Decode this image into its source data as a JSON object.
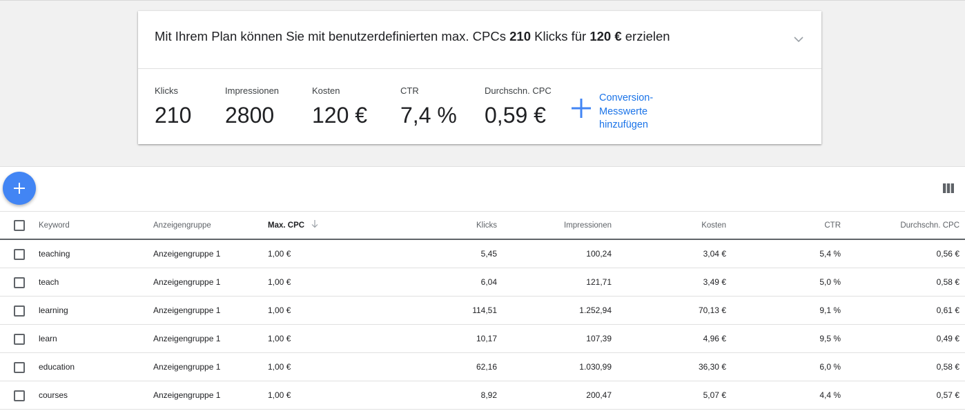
{
  "summary": {
    "plan_prefix": "Mit Ihrem Plan können Sie mit benutzerdefinierten max. CPCs ",
    "plan_clicks": "210",
    "plan_mid": " Klicks für ",
    "plan_cost": "120 €",
    "plan_suffix": " erzielen",
    "metrics": [
      {
        "label": "Klicks",
        "value": "210"
      },
      {
        "label": "Impressionen",
        "value": "2800"
      },
      {
        "label": "Kosten",
        "value": "120 €"
      },
      {
        "label": "CTR",
        "value": "7,4 %"
      },
      {
        "label": "Durchschn. CPC",
        "value": "0,59 €"
      }
    ],
    "conversion_line1": "Conversion-",
    "conversion_line2": "Messwerte",
    "conversion_line3": "hinzufügen"
  },
  "table": {
    "headers": {
      "keyword": "Keyword",
      "adgroup": "Anzeigengruppe",
      "maxcpc": "Max. CPC",
      "clicks": "Klicks",
      "impressions": "Impressionen",
      "cost": "Kosten",
      "ctr": "CTR",
      "avgcpc": "Durchschn. CPC"
    },
    "rows": [
      {
        "keyword": "teaching",
        "adgroup": "Anzeigengruppe 1",
        "maxcpc": "1,00 €",
        "clicks": "5,45",
        "impressions": "100,24",
        "cost": "3,04 €",
        "ctr": "5,4 %",
        "avgcpc": "0,56 €"
      },
      {
        "keyword": "teach",
        "adgroup": "Anzeigengruppe 1",
        "maxcpc": "1,00 €",
        "clicks": "6,04",
        "impressions": "121,71",
        "cost": "3,49 €",
        "ctr": "5,0 %",
        "avgcpc": "0,58 €"
      },
      {
        "keyword": "learning",
        "adgroup": "Anzeigengruppe 1",
        "maxcpc": "1,00 €",
        "clicks": "114,51",
        "impressions": "1.252,94",
        "cost": "70,13 €",
        "ctr": "9,1 %",
        "avgcpc": "0,61 €"
      },
      {
        "keyword": "learn",
        "adgroup": "Anzeigengruppe 1",
        "maxcpc": "1,00 €",
        "clicks": "10,17",
        "impressions": "107,39",
        "cost": "4,96 €",
        "ctr": "9,5 %",
        "avgcpc": "0,49 €"
      },
      {
        "keyword": "education",
        "adgroup": "Anzeigengruppe 1",
        "maxcpc": "1,00 €",
        "clicks": "62,16",
        "impressions": "1.030,99",
        "cost": "36,30 €",
        "ctr": "6,0 %",
        "avgcpc": "0,58 €"
      },
      {
        "keyword": "courses",
        "adgroup": "Anzeigengruppe 1",
        "maxcpc": "1,00 €",
        "clicks": "8,92",
        "impressions": "200,47",
        "cost": "5,07 €",
        "ctr": "4,4 %",
        "avgcpc": "0,57 €"
      }
    ]
  },
  "icons": {
    "expand": "chevron-down-icon",
    "add_conversion": "plus-icon",
    "fab": "add-icon",
    "columns": "columns-icon",
    "sort": "arrow-down-icon"
  },
  "colors": {
    "accent": "#4285f4",
    "link": "#1a73e8",
    "background": "#f1f1f1"
  }
}
